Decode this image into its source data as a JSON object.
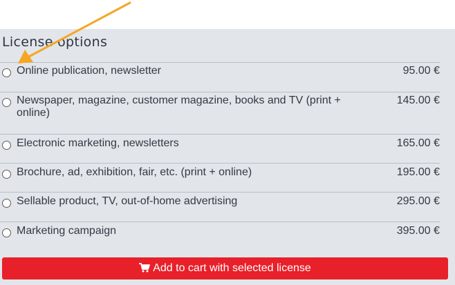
{
  "section": {
    "title": "License options"
  },
  "options": [
    {
      "label": "Online publication, newsletter",
      "price": "95.00 €"
    },
    {
      "label": "Newspaper, magazine, customer magazine, books and TV (print + online)",
      "price": "145.00 €"
    },
    {
      "label": "Electronic marketing, newsletters",
      "price": "165.00 €"
    },
    {
      "label": "Brochure, ad, exhibition, fair, etc. (print + online)",
      "price": "195.00 €"
    },
    {
      "label": "Sellable product, TV, out-of-home advertising",
      "price": "295.00 €"
    },
    {
      "label": "Marketing campaign",
      "price": "395.00 €"
    }
  ],
  "cart": {
    "label": "Add to cart with selected license",
    "icon": "shopping-cart-icon"
  },
  "annotation": {
    "icon": "pointer-arrow-icon",
    "color": "#f5a623"
  },
  "colors": {
    "panel_background": "#e2e5ea",
    "button_background": "#e8202a",
    "text": "#333a44"
  }
}
